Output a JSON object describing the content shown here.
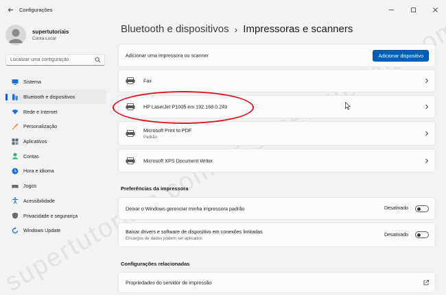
{
  "window": {
    "title": "Configurações"
  },
  "profile": {
    "name": "supertutoriais",
    "account": "Conta Local"
  },
  "search": {
    "placeholder": "Localizar uma configuração"
  },
  "nav": {
    "items": [
      {
        "label": "Sistema",
        "icon": "system-icon",
        "color": "#1e6fd9"
      },
      {
        "label": "Bluetooth e dispositivos",
        "icon": "bluetooth-icon",
        "color": "#1e6fd9",
        "active": true
      },
      {
        "label": "Rede e Internet",
        "icon": "wifi-icon",
        "color": "#1e6fd9"
      },
      {
        "label": "Personalização",
        "icon": "brush-icon",
        "color": "#d97a3b"
      },
      {
        "label": "Aplicativos",
        "icon": "apps-icon",
        "color": "#5b6470"
      },
      {
        "label": "Contas",
        "icon": "account-icon",
        "color": "#2bb673"
      },
      {
        "label": "Hora e idioma",
        "icon": "globe-clock-icon",
        "color": "#1e6fd9"
      },
      {
        "label": "Jogos",
        "icon": "gamepad-icon",
        "color": "#6b6b6b"
      },
      {
        "label": "Acessibilidade",
        "icon": "accessibility-icon",
        "color": "#1e6fd9"
      },
      {
        "label": "Privacidade e segurança",
        "icon": "shield-icon",
        "color": "#6b6b6b"
      },
      {
        "label": "Windows Update",
        "icon": "update-icon",
        "color": "#1e6fd9"
      }
    ]
  },
  "breadcrumb": {
    "parent": "Bluetooth e dispositivos",
    "separator": "›",
    "current": "Impressoras e scanners"
  },
  "add_device": {
    "label": "Adicionar uma impressora ou scanner",
    "button": "Adicionar dispositivo"
  },
  "devices": [
    {
      "name": "Fax",
      "sub": ""
    },
    {
      "name": "HP LaserJet P1005 em 192.168.0.249",
      "sub": ""
    },
    {
      "name": "Microsoft Print to PDF",
      "sub": "Padrão"
    },
    {
      "name": "Microsoft XPS Document Writer",
      "sub": ""
    }
  ],
  "preferences": {
    "title": "Preferências da impressora",
    "items": [
      {
        "label": "Deixar o Windows gerenciar minha impressora padrão",
        "sub": "",
        "state": "Desativado"
      },
      {
        "label": "Baixar drivers e software de dispositivo em conexões limitadas",
        "sub": "Encargos de dados podem ser aplicados",
        "state": "Desativado"
      }
    ]
  },
  "related": {
    "title": "Configurações relacionadas",
    "items": [
      {
        "label": "Propriedades do servidor de impressão"
      }
    ]
  },
  "watermark": {
    "text": "supertutoriais.com.br  supertutoriais.com.br"
  },
  "colors": {
    "accent": "#005fb8",
    "highlight": "#e0121a"
  }
}
